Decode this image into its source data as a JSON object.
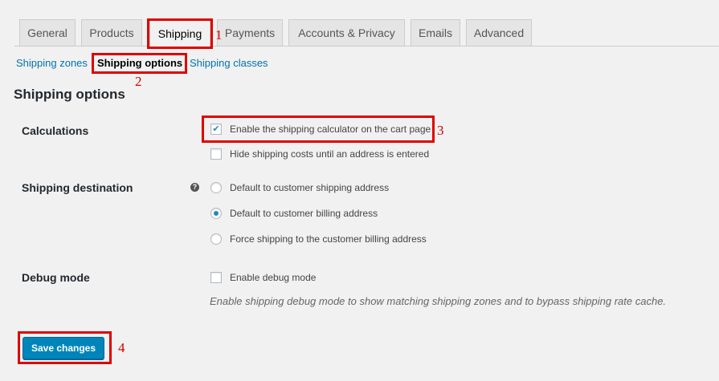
{
  "tabs": [
    {
      "label": "General"
    },
    {
      "label": "Products"
    },
    {
      "label": "Shipping"
    },
    {
      "label": "Payments"
    },
    {
      "label": "Accounts & Privacy"
    },
    {
      "label": "Emails"
    },
    {
      "label": "Advanced"
    }
  ],
  "subnav": {
    "zones": "Shipping zones",
    "options": "Shipping options",
    "classes": "Shipping classes"
  },
  "section": {
    "title": "Shipping options"
  },
  "calculations": {
    "label": "Calculations",
    "options": [
      {
        "text": "Enable the shipping calculator on the cart page",
        "checked": true
      },
      {
        "text": "Hide shipping costs until an address is entered",
        "checked": false
      }
    ]
  },
  "destination": {
    "label": "Shipping destination",
    "help_icon": "help-icon",
    "options": [
      {
        "text": "Default to customer shipping address",
        "selected": false
      },
      {
        "text": "Default to customer billing address",
        "selected": true
      },
      {
        "text": "Force shipping to the customer billing address",
        "selected": false
      }
    ]
  },
  "debug": {
    "label": "Debug mode",
    "option": {
      "text": "Enable debug mode",
      "checked": false
    },
    "description": "Enable shipping debug mode to show matching shipping zones and to bypass shipping rate cache."
  },
  "save_button": {
    "label": "Save changes"
  },
  "annotations": {
    "n1": "1",
    "n2": "2",
    "n3": "3",
    "n4": "4"
  },
  "colors": {
    "accent": "#0085ba",
    "link": "#0073aa",
    "annotation": "#e00000"
  }
}
